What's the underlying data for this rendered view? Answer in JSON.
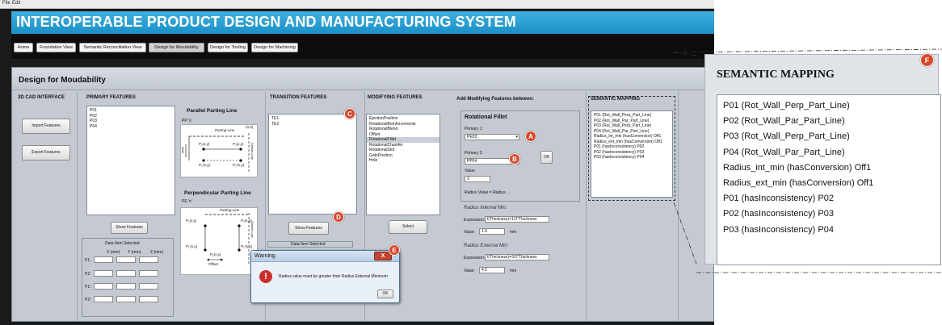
{
  "menu": {
    "file": "File",
    "edit": "Edit"
  },
  "app_title": "INTEROPERABLE PRODUCT DESIGN AND MANUFACTURING SYSTEM",
  "nav": [
    "Home",
    "Foundation View",
    "Semantic Reconciliation View",
    "Design for Moudability",
    "Design for Tooling",
    "Design for Machining"
  ],
  "page_title": "Design for Moudability",
  "cad": {
    "header": "3D CAD INTERFACE",
    "import_label": "Import Features",
    "export_label": "Export Features"
  },
  "primary": {
    "header": "PRIMARY FEATURES",
    "items": [
      "P01",
      "P02",
      "P03",
      "P04"
    ],
    "show_label": "Show Features",
    "data_item_title": "Data Item Selected",
    "col_x": "X (mm)",
    "col_y": "Y (mm)",
    "col_z": "Z (mm)",
    "rows": [
      "P1:",
      "P2:",
      "P1':",
      "P2':"
    ]
  },
  "parting": {
    "parallel_title": "Parallel Parting Line",
    "parallel_code": "PP 'n'",
    "perp_title": "Perpendicular Parting Line",
    "perp_code": "PE 'n'",
    "parting_line": "Parting-Line",
    "center_line": "Center-Line",
    "wall": "Wall",
    "offset": "Offset",
    "origin": "(0,0)",
    "p1": "P₁(x,y)",
    "p2": "P₂(x,y)",
    "p1p": "P₁'(x,y)",
    "p2p": "P₂'(x,y)",
    "pp": "P₂(x,y)"
  },
  "transition": {
    "header": "TRANSITION FEATURES",
    "items": [
      "TE1",
      "TE2"
    ],
    "show_label": "Show Features",
    "data_item_title": "Data Item Selected"
  },
  "modifying": {
    "header": "MODIFYING FEATURES",
    "items": [
      "EjectionPosition",
      "RotationalReinforcements",
      "RotationalBlend",
      "Offset",
      "RotationalFillet",
      "RotationalChamfer",
      "RotationalSlot",
      "GatePosition",
      "Hole"
    ],
    "selected_index": 4,
    "select_label": "Select"
  },
  "add_modifying": {
    "header": "Add Modifying Features between:",
    "box_title": "Rotational Fillet",
    "primary1_label": "Primary 1:",
    "primary1_value": "PE03",
    "primary2_label": "Primary 2:",
    "primary2_value": "PP04",
    "ok_label": "OK",
    "value_label": "Value:",
    "value": "3",
    "radius_text": "Radius Value = Radius ...",
    "int_title": "Radius Internal Min:",
    "ext_title": "Radius External Min:",
    "expr_label": "Expression:",
    "int_expr": "f(Thickness)=1/2*Thickness",
    "ext_expr": "f(Thickness)=3/2*Thickness",
    "value_label2": "Value:",
    "int_value": "1.5",
    "ext_value": "4.5",
    "unit": "mm"
  },
  "semantic": {
    "header": "SEMANTIC MAPPING",
    "items": [
      "P01 (Rot_Wall_Perp_Part_Line)",
      "P02 (Rot_Wall_Par_Part_Line)",
      "P03 (Rot_Wall_Perp_Part_Line)",
      "P04 (Rot_Wall_Par_Part_Line)",
      "Radius_int_min (hasConversion) Off1",
      "Radius_ext_min (hasConversion) Off1",
      "P01 (hasInconsistency) P02",
      "P02 (hasInconsistency) P03",
      "P03 (hasInconsistency) P04"
    ]
  },
  "dialog": {
    "title": "Warning",
    "message": "Radius value must be greater than Radius External Minimum",
    "ok_label": "OK",
    "close": "X"
  },
  "callout": {
    "title": "SEMANTIC MAPPING",
    "items": [
      "P01 (Rot_Wall_Perp_Part_Line)",
      "P02 (Rot_Wall_Par_Part_Line)",
      "P03 (Rot_Wall_Perp_Part_Line)",
      "P04 (Rot_Wall_Par_Part_Line)",
      "Radius_int_min (hasConversion) Off1",
      "Radius_ext_min (hasConversion) Off1",
      "P01 (hasInconsistency) P02",
      "P02 (hasInconsistency) P03",
      "P03 (hasInconsistency) P04"
    ]
  },
  "markers": {
    "a": "A",
    "b": "B",
    "c": "C",
    "d": "D",
    "e": "E",
    "f": "F"
  },
  "colors": {
    "title_bar": "#1b8fc7",
    "marker": "#d9462a",
    "panel": "#c5cad2",
    "dialog_icon": "#c9302c"
  },
  "icons": {
    "error": "error-icon",
    "dropdown": "chevron-down-icon"
  }
}
